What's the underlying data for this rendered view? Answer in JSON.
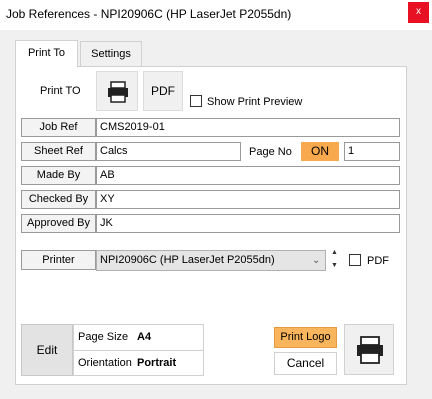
{
  "window": {
    "title": "Job References - NPI20906C (HP LaserJet P2055dn)",
    "close_glyph": "x"
  },
  "tabs": [
    {
      "label": "Print To",
      "active": true
    },
    {
      "label": "Settings",
      "active": false
    }
  ],
  "print_to": {
    "label": "Print TO",
    "printer_icon": "printer-icon",
    "pdf_label": "PDF",
    "show_preview_label": "Show Print Preview",
    "show_preview_checked": false
  },
  "fields": {
    "job_ref": {
      "label": "Job Ref",
      "value": "CMS2019-01"
    },
    "sheet_ref": {
      "label": "Sheet Ref",
      "value": "Calcs"
    },
    "page_no": {
      "label": "Page No",
      "toggle": "ON",
      "value": "1"
    },
    "made_by": {
      "label": "Made By",
      "value": "AB"
    },
    "checked_by": {
      "label": "Checked By",
      "value": "XY"
    },
    "approved_by": {
      "label": "Approved By",
      "value": "JK"
    }
  },
  "printer": {
    "label": "Printer",
    "selected": "NPI20906C (HP LaserJet P2055dn)",
    "pdf_label": "PDF",
    "pdf_checked": false
  },
  "page_setup": {
    "edit_label": "Edit",
    "page_size_label": "Page Size",
    "page_size_value": "A4",
    "orientation_label": "Orientation",
    "orientation_value": "Portrait"
  },
  "actions": {
    "print_logo_label": "Print Logo",
    "cancel_label": "Cancel",
    "print_icon": "printer-icon"
  },
  "colors": {
    "accent_orange": "#f9a94d",
    "close_red": "#e81123"
  }
}
